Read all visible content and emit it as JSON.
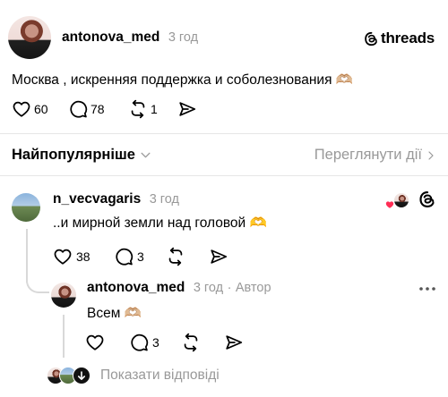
{
  "post": {
    "username": "antonova_med",
    "time": "3 год",
    "brand": "threads",
    "text": "Москва , искренняя поддержка и соболезнования 🫶🏼",
    "likes": "60",
    "comments": "78",
    "reposts": "1"
  },
  "sort": {
    "label": "Найпопулярніше",
    "activity_label": "Переглянути дії"
  },
  "reply1": {
    "username": "n_vecvagaris",
    "time": "3 год",
    "text": "..и мирной земли над головой 🫶",
    "likes": "38",
    "comments": "3"
  },
  "reply2": {
    "username": "antonova_med",
    "time": "3 год",
    "author_tag": "Автор",
    "text": "Всем 🫶🏼",
    "comments": "3"
  },
  "show_replies": {
    "label": "Показати відповіді"
  }
}
